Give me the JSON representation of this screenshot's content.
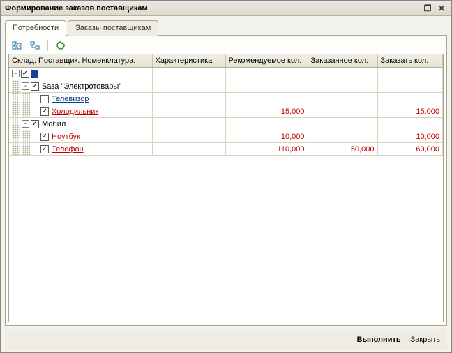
{
  "window": {
    "title": "Формирование заказов поставщикам",
    "btn_restore": "❐",
    "btn_close": "✕"
  },
  "tabs": {
    "needs": "Потребности",
    "orders": "Заказы поставщикам"
  },
  "toolbar": {
    "expand_icon": "expand-tree-icon",
    "collapse_icon": "collapse-tree-icon",
    "refresh_icon": "refresh-icon"
  },
  "columns": {
    "tree": "Склад. Поставщик. Номенклатура.",
    "char": "Характеристика",
    "recommended": "Рекомендуемое кол.",
    "ordered": "Заказанное кол.",
    "to_order": "Заказать кол."
  },
  "rows": [
    {
      "level": 0,
      "expander": "-",
      "checked": true,
      "label": "",
      "root_selected": true
    },
    {
      "level": 1,
      "expander": "-",
      "checked": true,
      "label": "База \"Электротовары\"",
      "link": "black"
    },
    {
      "level": 2,
      "expander": "",
      "checked": false,
      "label": "Телевизор",
      "link": "blue"
    },
    {
      "level": 2,
      "expander": "",
      "checked": true,
      "label": "Холодильник",
      "link": "red",
      "recommended": "15,000",
      "to_order": "15,000"
    },
    {
      "level": 1,
      "expander": "-",
      "checked": true,
      "label": "Мобил",
      "link": "black"
    },
    {
      "level": 2,
      "expander": "",
      "checked": true,
      "label": "Ноутбук",
      "link": "red",
      "recommended": "10,000",
      "to_order": "10,000"
    },
    {
      "level": 2,
      "expander": "",
      "checked": true,
      "label": "Телефон",
      "link": "red",
      "recommended": "110,000",
      "ordered": "50,000",
      "to_order": "60,000"
    }
  ],
  "footer": {
    "execute": "Выполнить",
    "close": "Закрыть"
  }
}
